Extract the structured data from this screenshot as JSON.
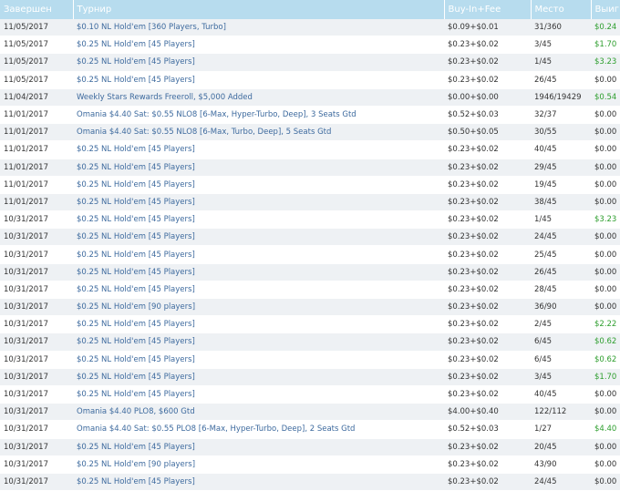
{
  "headers": {
    "completed": "Завершен",
    "tournament": "Турнир",
    "buyin": "Buy-In+Fee",
    "place": "Место",
    "winnings": "Выиг"
  },
  "rows": [
    {
      "date": "11/05/2017",
      "name": "$0.10 NL Hold'em [360 Players, Turbo]",
      "buyin": "$0.09+$0.01",
      "place": "31/360",
      "win": "$0.24"
    },
    {
      "date": "11/05/2017",
      "name": "$0.25 NL Hold'em [45 Players]",
      "buyin": "$0.23+$0.02",
      "place": "3/45",
      "win": "$1.70"
    },
    {
      "date": "11/05/2017",
      "name": "$0.25 NL Hold'em [45 Players]",
      "buyin": "$0.23+$0.02",
      "place": "1/45",
      "win": "$3.23"
    },
    {
      "date": "11/05/2017",
      "name": "$0.25 NL Hold'em [45 Players]",
      "buyin": "$0.23+$0.02",
      "place": "26/45",
      "win": "$0.00"
    },
    {
      "date": "11/04/2017",
      "name": "Weekly Stars Rewards Freeroll, $5,000 Added",
      "buyin": "$0.00+$0.00",
      "place": "1946/19429",
      "win": "$0.54"
    },
    {
      "date": "11/01/2017",
      "name": "Omania $4.40 Sat: $0.55 NLO8 [6-Max, Hyper-Turbo, Deep], 3 Seats Gtd",
      "buyin": "$0.52+$0.03",
      "place": "32/37",
      "win": "$0.00"
    },
    {
      "date": "11/01/2017",
      "name": "Omania $4.40 Sat: $0.55 NLO8 [6-Max, Turbo, Deep], 5 Seats Gtd",
      "buyin": "$0.50+$0.05",
      "place": "30/55",
      "win": "$0.00"
    },
    {
      "date": "11/01/2017",
      "name": "$0.25 NL Hold'em [45 Players]",
      "buyin": "$0.23+$0.02",
      "place": "40/45",
      "win": "$0.00"
    },
    {
      "date": "11/01/2017",
      "name": "$0.25 NL Hold'em [45 Players]",
      "buyin": "$0.23+$0.02",
      "place": "29/45",
      "win": "$0.00"
    },
    {
      "date": "11/01/2017",
      "name": "$0.25 NL Hold'em [45 Players]",
      "buyin": "$0.23+$0.02",
      "place": "19/45",
      "win": "$0.00"
    },
    {
      "date": "11/01/2017",
      "name": "$0.25 NL Hold'em [45 Players]",
      "buyin": "$0.23+$0.02",
      "place": "38/45",
      "win": "$0.00"
    },
    {
      "date": "10/31/2017",
      "name": "$0.25 NL Hold'em [45 Players]",
      "buyin": "$0.23+$0.02",
      "place": "1/45",
      "win": "$3.23"
    },
    {
      "date": "10/31/2017",
      "name": "$0.25 NL Hold'em [45 Players]",
      "buyin": "$0.23+$0.02",
      "place": "24/45",
      "win": "$0.00"
    },
    {
      "date": "10/31/2017",
      "name": "$0.25 NL Hold'em [45 Players]",
      "buyin": "$0.23+$0.02",
      "place": "25/45",
      "win": "$0.00"
    },
    {
      "date": "10/31/2017",
      "name": "$0.25 NL Hold'em [45 Players]",
      "buyin": "$0.23+$0.02",
      "place": "26/45",
      "win": "$0.00"
    },
    {
      "date": "10/31/2017",
      "name": "$0.25 NL Hold'em [45 Players]",
      "buyin": "$0.23+$0.02",
      "place": "28/45",
      "win": "$0.00"
    },
    {
      "date": "10/31/2017",
      "name": "$0.25 NL Hold'em [90 players]",
      "buyin": "$0.23+$0.02",
      "place": "36/90",
      "win": "$0.00"
    },
    {
      "date": "10/31/2017",
      "name": "$0.25 NL Hold'em [45 Players]",
      "buyin": "$0.23+$0.02",
      "place": "2/45",
      "win": "$2.22"
    },
    {
      "date": "10/31/2017",
      "name": "$0.25 NL Hold'em [45 Players]",
      "buyin": "$0.23+$0.02",
      "place": "6/45",
      "win": "$0.62"
    },
    {
      "date": "10/31/2017",
      "name": "$0.25 NL Hold'em [45 Players]",
      "buyin": "$0.23+$0.02",
      "place": "6/45",
      "win": "$0.62"
    },
    {
      "date": "10/31/2017",
      "name": "$0.25 NL Hold'em [45 Players]",
      "buyin": "$0.23+$0.02",
      "place": "3/45",
      "win": "$1.70"
    },
    {
      "date": "10/31/2017",
      "name": "$0.25 NL Hold'em [45 Players]",
      "buyin": "$0.23+$0.02",
      "place": "40/45",
      "win": "$0.00"
    },
    {
      "date": "10/31/2017",
      "name": "Omania $4.40 PLO8, $600 Gtd",
      "buyin": "$4.00+$0.40",
      "place": "122/112",
      "win": "$0.00"
    },
    {
      "date": "10/31/2017",
      "name": "Omania $4.40 Sat: $0.55 PLO8 [6-Max, Hyper-Turbo, Deep], 2 Seats Gtd",
      "buyin": "$0.52+$0.03",
      "place": "1/27",
      "win": "$4.40"
    },
    {
      "date": "10/31/2017",
      "name": "$0.25 NL Hold'em [45 Players]",
      "buyin": "$0.23+$0.02",
      "place": "20/45",
      "win": "$0.00"
    },
    {
      "date": "10/31/2017",
      "name": "$0.25 NL Hold'em [90 players]",
      "buyin": "$0.23+$0.02",
      "place": "43/90",
      "win": "$0.00"
    },
    {
      "date": "10/31/2017",
      "name": "$0.25 NL Hold'em [45 Players]",
      "buyin": "$0.23+$0.02",
      "place": "24/45",
      "win": "$0.00"
    }
  ],
  "colors": {
    "header_bg": "#b7dcee",
    "row_alt_bg": "#eef1f4",
    "link": "#3d6a9e",
    "positive_win": "#2e9e2e"
  }
}
